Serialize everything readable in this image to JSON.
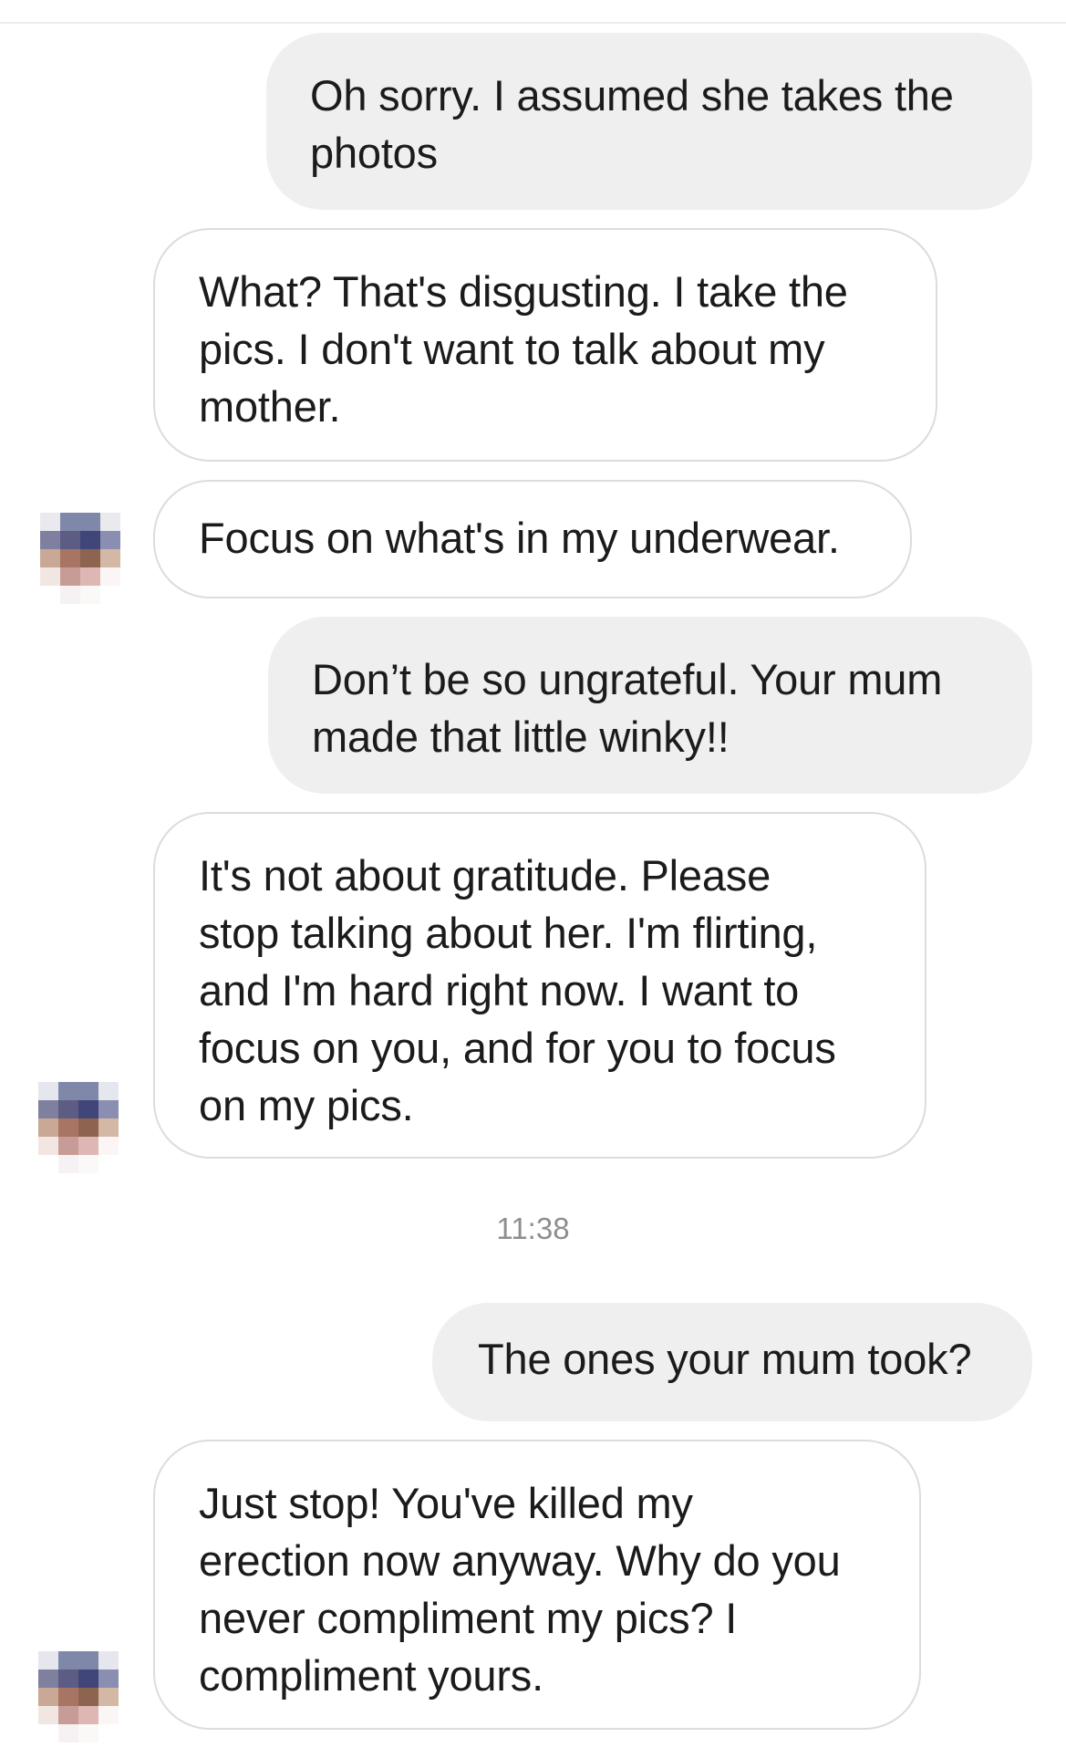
{
  "conversation": {
    "messages": [
      {
        "sender": "me",
        "text": "Oh sorry. I assumed she takes the\nphotos"
      },
      {
        "sender": "them",
        "text": "What? That's disgusting. I take the\npics. I don't want to talk about my\nmother."
      },
      {
        "sender": "them",
        "text": "Focus on what's in my underwear."
      },
      {
        "sender": "me",
        "text": "Don’t be so ungrateful. Your mum\nmade that little winky!!"
      },
      {
        "sender": "them",
        "text": "It's not about gratitude. Please\nstop talking about her. I'm flirting,\nand I'm hard right now. I want to\nfocus on you, and for you to focus\non my pics."
      },
      {
        "sender": "me",
        "text": "The ones your mum took?"
      },
      {
        "sender": "them",
        "text": "Just stop! You've killed my\nerection now anyway. Why do you\nnever compliment my pics? I\ncompliment yours."
      }
    ],
    "timestamp": "11:38"
  },
  "colors": {
    "sent_bubble": "#efefef",
    "received_border": "#dcdcdc",
    "timestamp_text": "#8e8e8e"
  }
}
